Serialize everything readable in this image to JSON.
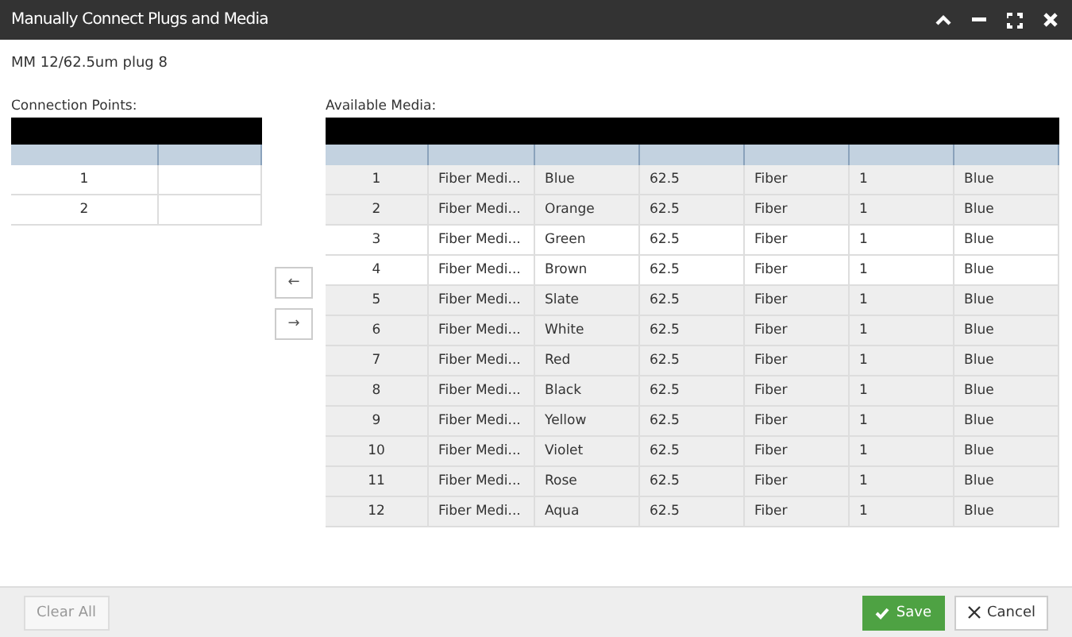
{
  "window": {
    "title": "Manually Connect Plugs and Media"
  },
  "subtitle": "MM 12/62.5um plug 8",
  "connection_points": {
    "label": "Connection Points:",
    "rows": [
      [
        "1",
        ""
      ],
      [
        "2",
        ""
      ]
    ]
  },
  "available_media": {
    "label": "Available Media:",
    "rows": [
      {
        "shaded": true,
        "cells": [
          "1",
          "Fiber Medi...",
          "Blue",
          "62.5",
          "Fiber",
          "1",
          "Blue"
        ]
      },
      {
        "shaded": true,
        "cells": [
          "2",
          "Fiber Medi...",
          "Orange",
          "62.5",
          "Fiber",
          "1",
          "Blue"
        ]
      },
      {
        "shaded": false,
        "cells": [
          "3",
          "Fiber Medi...",
          "Green",
          "62.5",
          "Fiber",
          "1",
          "Blue"
        ]
      },
      {
        "shaded": false,
        "cells": [
          "4",
          "Fiber Medi...",
          "Brown",
          "62.5",
          "Fiber",
          "1",
          "Blue"
        ]
      },
      {
        "shaded": true,
        "cells": [
          "5",
          "Fiber Medi...",
          "Slate",
          "62.5",
          "Fiber",
          "1",
          "Blue"
        ]
      },
      {
        "shaded": true,
        "cells": [
          "6",
          "Fiber Medi...",
          "White",
          "62.5",
          "Fiber",
          "1",
          "Blue"
        ]
      },
      {
        "shaded": true,
        "cells": [
          "7",
          "Fiber Medi...",
          "Red",
          "62.5",
          "Fiber",
          "1",
          "Blue"
        ]
      },
      {
        "shaded": true,
        "cells": [
          "8",
          "Fiber Medi...",
          "Black",
          "62.5",
          "Fiber",
          "1",
          "Blue"
        ]
      },
      {
        "shaded": true,
        "cells": [
          "9",
          "Fiber Medi...",
          "Yellow",
          "62.5",
          "Fiber",
          "1",
          "Blue"
        ]
      },
      {
        "shaded": true,
        "cells": [
          "10",
          "Fiber Medi...",
          "Violet",
          "62.5",
          "Fiber",
          "1",
          "Blue"
        ]
      },
      {
        "shaded": true,
        "cells": [
          "11",
          "Fiber Medi...",
          "Rose",
          "62.5",
          "Fiber",
          "1",
          "Blue"
        ]
      },
      {
        "shaded": true,
        "cells": [
          "12",
          "Fiber Medi...",
          "Aqua",
          "62.5",
          "Fiber",
          "1",
          "Blue"
        ]
      }
    ]
  },
  "move_buttons": [
    "←",
    "→"
  ],
  "footer": {
    "clear_button": "Clear All",
    "disabled": true,
    "save_button": "Save",
    "cancel_button": "Cancel"
  }
}
